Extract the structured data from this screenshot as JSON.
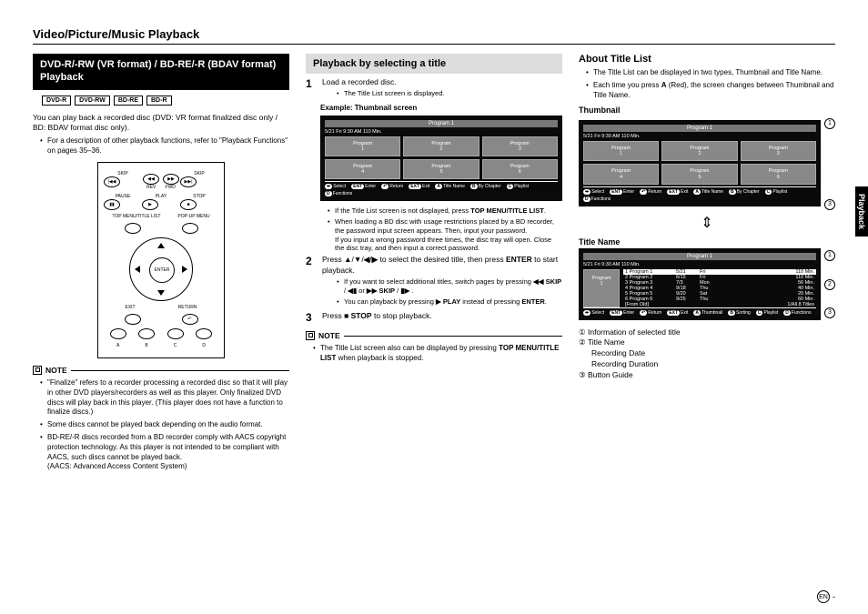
{
  "pageTitle": "Video/Picture/Music Playback",
  "sideTab": "Playback",
  "col1": {
    "header": "DVD-R/-RW (VR format) / BD-RE/-R (BDAV format) Playback",
    "badges": [
      "DVD-R",
      "DVD-RW",
      "BD-RE",
      "BD-R"
    ],
    "intro": "You can play back a recorded disc (DVD: VR format finalized disc only / BD: BDAV format disc only).",
    "introBullet": "For a description of other playback functions, refer to \"Playback Functions\" on pages 35–36.",
    "remote": {
      "row1": [
        "SKIP",
        "",
        "SKIP"
      ],
      "row1b": [
        "REV",
        "FWD"
      ],
      "row2labels": [
        "PAUSE",
        "PLAY",
        "STOP"
      ],
      "topmenu": "TOP MENU/TITLE LIST",
      "popup": "POP-UP MENU",
      "enter": "ENTER",
      "bottomLeft": "EXIT",
      "bottomRight": "RETURN",
      "letters": [
        "A",
        "B",
        "C",
        "D"
      ]
    },
    "noteLabel": "NOTE",
    "notes": [
      "\"Finalize\" refers to a recorder processing a recorded disc so that it will play in other DVD players/recorders as well as this player. Only finalized DVD discs will play back in this player. (This player does not have a function to finalize discs.)",
      "Some discs cannot be played back depending on the audio format.",
      "BD-RE/-R discs recorded from a BD recorder comply with AACS copyright protection technology. As this player is not intended to be compliant with AACS, such discs cannot be played back.\n(AACS: Advanced Access Content System)"
    ]
  },
  "col2": {
    "header": "Playback by selecting a title",
    "step1": "Load a recorded disc.",
    "step1sub": "The Title List screen is displayed.",
    "exampleLabel": "Example: Thumbnail screen",
    "screen": {
      "title": "Program 1",
      "sub": "5/21    Fri    9:30 AM    110 Min.",
      "cells": [
        "Program\n1",
        "Program\n2",
        "Program\n3",
        "Program\n4",
        "Program\n5",
        "Program\n6"
      ],
      "foot": {
        "select": "Select",
        "a": "Title Name",
        "enter": "Enter",
        "b": "By Chapter",
        "return": "Return",
        "c": "Playlist",
        "exit": "Exit",
        "d": "Functions"
      }
    },
    "afterScreen": [
      "If the Title List screen is not displayed, press TOP MENU/TITLE LIST.",
      "When loading a BD disc with usage restrictions placed by a BD recorder, the password input screen appears. Then, input your password.\nIf you input a wrong password three times, the disc tray will open. Close the disc tray, and then input a correct password."
    ],
    "step2": "Press ▲/▼/◀/▶ to select the desired title, then press ENTER to start playback.",
    "step2subs": [
      "If you want to select additional titles, switch pages by pressing ◀◀ SKIP / ◀▮ or ▶▶ SKIP / ▮▶ .",
      "You can playback by pressing ▶ PLAY instead of pressing ENTER."
    ],
    "step3": "Press ■ STOP to stop playback.",
    "noteLabel": "NOTE",
    "bottomNote": "The Title List screen also can be displayed by pressing TOP MENU/TITLE LIST when playback is stopped."
  },
  "col3": {
    "header": "About Title List",
    "bullets": [
      "The Title List can be displayed in two types, Thumbnail and Title Name.",
      "Each time you press A (Red), the screen changes between Thumbnail and Title Name."
    ],
    "thumbLabel": "Thumbnail",
    "thumbScreen": {
      "title": "Program 1",
      "sub": "5/21    Fri    9:30 AM    110 Min.",
      "cells": [
        "Program\n1",
        "Program\n2",
        "Program\n3",
        "Program\n4",
        "Program\n5",
        "Program\n6"
      ],
      "foot": {
        "select": "Select",
        "a": "Title Name",
        "enter": "Enter",
        "b": "By Chapter",
        "return": "Return",
        "c": "Playlist",
        "exit": "Exit",
        "d": "Functions"
      }
    },
    "titleNameLabel": "Title Name",
    "titleScreen": {
      "title": "Program 1",
      "sub": "5/21    Fri    9:30 AM    110 Min.",
      "thumb": "Program\n1",
      "rows": [
        {
          "n": "1 Program 1",
          "d": "5/21",
          "w": "Fri",
          "m": "110 Min."
        },
        {
          "n": "2 Program 2",
          "d": "6/15",
          "w": "Fri",
          "m": "110 Min."
        },
        {
          "n": "3 Program 3",
          "d": "7/3",
          "w": "Mon",
          "m": "56 Min."
        },
        {
          "n": "4 Program 4",
          "d": "9/18",
          "w": "Thu",
          "m": "40 Min."
        },
        {
          "n": "5 Program 5",
          "d": "9/20",
          "w": "Sat",
          "m": "20 Min."
        },
        {
          "n": "6 Program 6",
          "d": "9/25",
          "w": "Thu",
          "m": "60 Min."
        }
      ],
      "fromOld": "[From Old]",
      "pager": "1/All  8 Titles",
      "foot": {
        "select": "Select",
        "a": "Thumbnail",
        "enter": "Enter",
        "b": "Sorting",
        "return": "Return",
        "c": "Playlist",
        "exit": "Exit",
        "d": "Functions"
      }
    },
    "legend": [
      "① Information of selected title",
      "② Title Name",
      "    Recording Date",
      "    Recording Duration",
      "③ Button Guide"
    ]
  },
  "enMark": "EN"
}
